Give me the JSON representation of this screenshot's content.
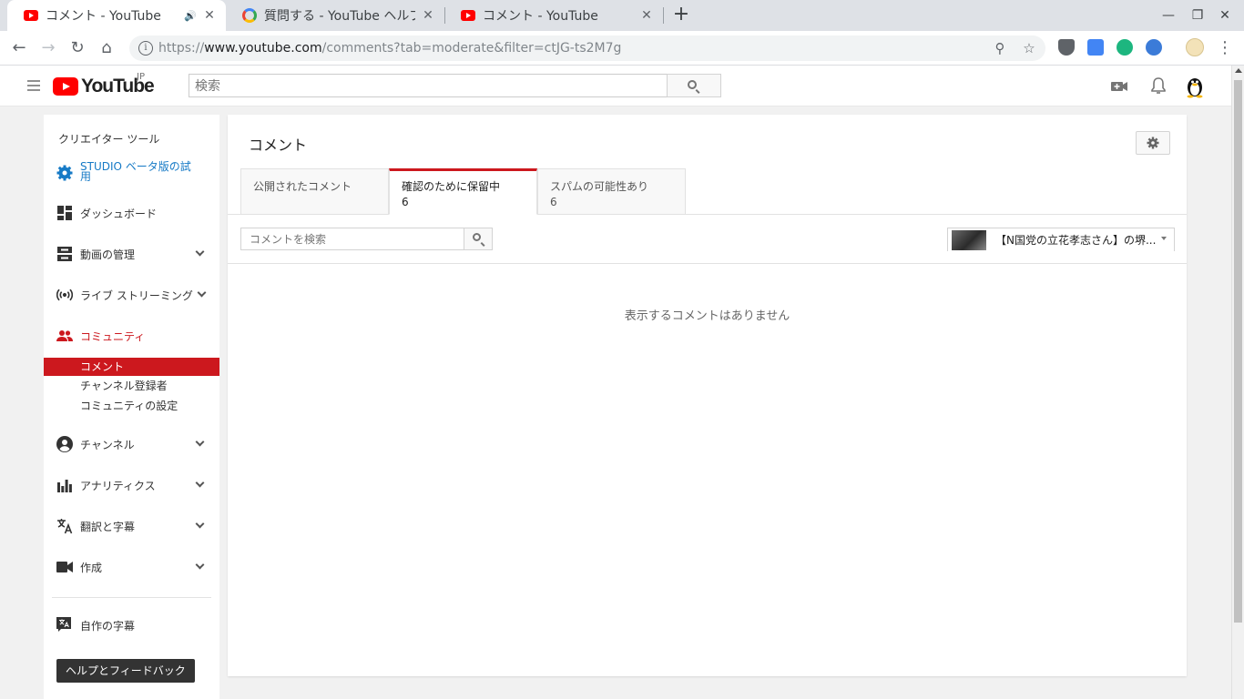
{
  "browser": {
    "tabs": [
      {
        "title": "コメント - YouTube",
        "favicon": "youtube-favicon",
        "active": true,
        "audio": true
      },
      {
        "title": "質問する - YouTube ヘルプ",
        "favicon": "google-favicon",
        "active": false
      },
      {
        "title": "コメント - YouTube",
        "favicon": "youtube-favicon",
        "active": false
      }
    ],
    "new_tab_label": "+",
    "url_scheme": "https://",
    "url_host": "www.youtube.com",
    "url_path": "/comments?tab=moderate&filter=ctJG-ts2M7g"
  },
  "masthead": {
    "logo_text": "YouTube",
    "region": "JP",
    "search_placeholder": "検索"
  },
  "sidebar": {
    "header": "クリエイター ツール",
    "studio_beta": "STUDIO ベータ版の試用",
    "items": {
      "dashboard": "ダッシュボード",
      "video_manager": "動画の管理",
      "live": "ライブ ストリーミング",
      "community": "コミュニティ",
      "channel": "チャンネル",
      "analytics": "アナリティクス",
      "translations": "翻訳と字幕",
      "create": "作成",
      "my_subtitles": "自作の字幕"
    },
    "community_sub": [
      "コメント",
      "チャンネル登録者",
      "コミュニティの設定"
    ],
    "help_button": "ヘルプとフィードバック"
  },
  "main": {
    "title": "コメント",
    "tabs": [
      {
        "label": "公開されたコメント",
        "count": ""
      },
      {
        "label": "確認のために保留中",
        "count": "6"
      },
      {
        "label": "スパムの可能性あり",
        "count": "6"
      }
    ],
    "search_placeholder": "コメントを検索",
    "video_filter": "【N国党の立花孝志さん】の堺...",
    "empty_message": "表示するコメントはありません"
  },
  "colors": {
    "youtube_red": "#ff0000",
    "active_red": "#cc181e",
    "link_blue": "#167ac6"
  }
}
